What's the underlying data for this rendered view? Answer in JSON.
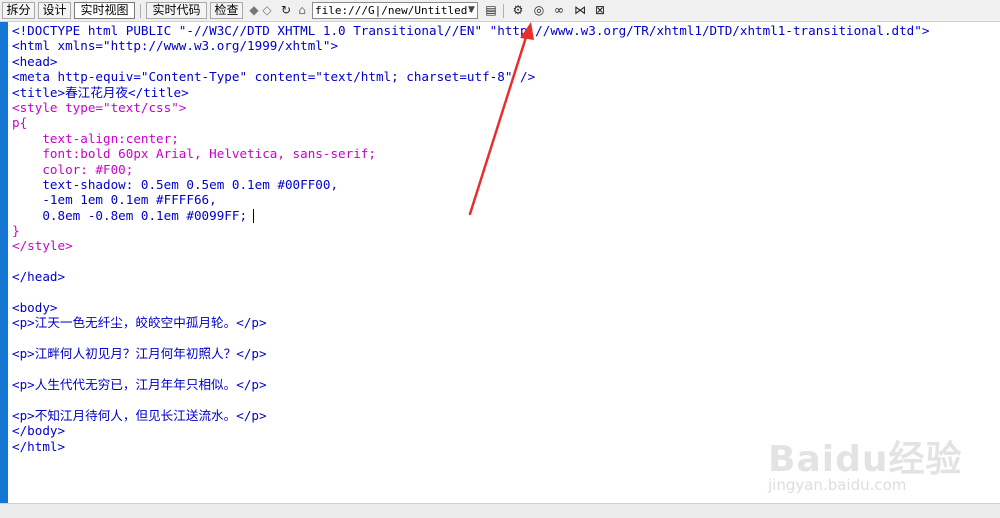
{
  "toolbar": {
    "split_label": "拆分",
    "design_label": "设计",
    "live_view_label": "实时视图",
    "live_code_label": "实时代码",
    "inspect_label": "检查",
    "address_value": "file:///G|/new/Untitled-",
    "icons": [
      "back-arrow-icon",
      "forward-arrow-icon",
      "refresh-icon",
      "home-icon",
      "dropdown-icon",
      "page-options-icon",
      "browser-check-icon",
      "preview-icon",
      "binoculars-icon",
      "tree-icon",
      "visual-aids-icon"
    ]
  },
  "editor": {
    "lines": [
      "<!DOCTYPE html PUBLIC \"-//W3C//DTD XHTML 1.0 Transitional//EN\" \"http://www.w3.org/TR/xhtml1/DTD/xhtml1-transitional.dtd\">",
      "<html xmlns=\"http://www.w3.org/1999/xhtml\">",
      "<head>",
      "<meta http-equiv=\"Content-Type\" content=\"text/html; charset=utf-8\" />",
      "<title>春江花月夜</title>",
      "<style type=\"text/css\">",
      "p{",
      "    text-align:center;",
      "    font:bold 60px Arial, Helvetica, sans-serif;",
      "    color: #F00;",
      "    text-shadow: 0.5em 0.5em 0.1em #00FF00,",
      "    -1em 1em 0.1em #FFFF66,",
      "    0.8em -0.8em 0.1em #0099FF;",
      "}",
      "</style>",
      "",
      "</head>",
      "",
      "<body>",
      "<p>江天一色无纤尘，皎皎空中孤月轮。</p>",
      "",
      "<p>江畔何人初见月？江月何年初照人？</p>",
      "",
      "<p>人生代代无穷已，江月年年只相似。</p>",
      "",
      "<p>不知江月待何人，但见长江送流水。</p>",
      "</body>",
      "</html>"
    ]
  },
  "watermark": {
    "brand": "Baidu经验",
    "url": "jingyan.baidu.com"
  },
  "colors": {
    "tag": "#0000cc",
    "css": "#cc00cc",
    "gutter": "#1476d2",
    "arrow": "#e8302a"
  }
}
